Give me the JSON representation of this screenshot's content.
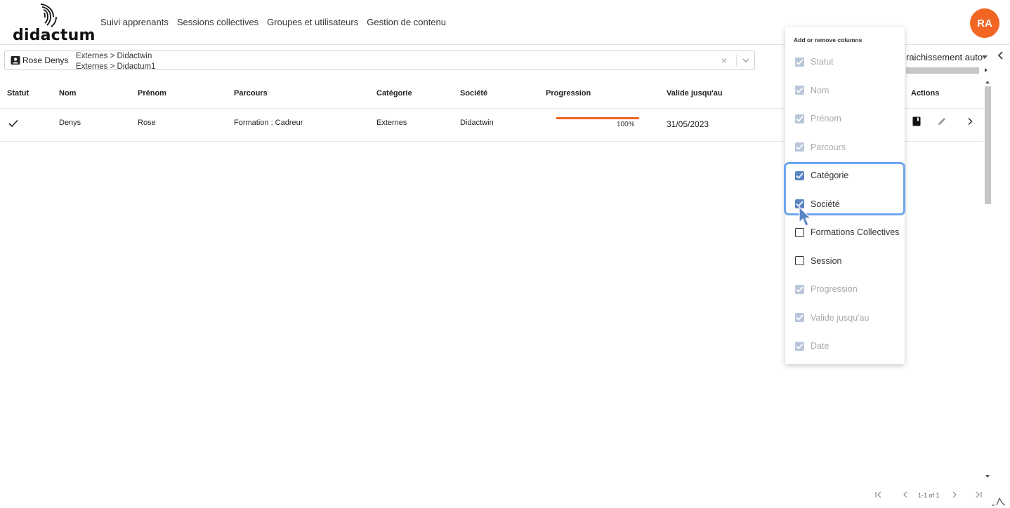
{
  "app": {
    "logo_text": "didactum",
    "nav": [
      "Suivi apprenants",
      "Sessions collectives",
      "Groupes et utilisateurs",
      "Gestion de contenu"
    ],
    "avatar_initials": "RA",
    "accent_color": "#f26522"
  },
  "filter": {
    "chip_label": "Rose Denys",
    "paths": [
      "Externes > Didactwin",
      "Externes > Didactum1"
    ],
    "clear_symbol": "×"
  },
  "toolbar": {
    "refresh_label": "raichissement auto"
  },
  "table": {
    "columns": [
      "Statut",
      "Nom",
      "Prénom",
      "Parcours",
      "Catégorie",
      "Société",
      "Progression",
      "Valide jusqu'au",
      "Actions"
    ],
    "rows": [
      {
        "statut": "check-icon",
        "nom": "Denys",
        "prenom": "Rose",
        "parcours": "Formation : Cadreur",
        "categorie": "Externes",
        "societe": "Didactwin",
        "progression_pct": 100,
        "progression_label": "100%",
        "valide": "31/05/2023"
      }
    ]
  },
  "pagination": {
    "range": "1-1 of 1"
  },
  "column_menu": {
    "title": "Add or remove columns",
    "options": [
      {
        "label": "Statut",
        "state": "disabled-checked"
      },
      {
        "label": "Nom",
        "state": "disabled-checked"
      },
      {
        "label": "Prénom",
        "state": "disabled-checked"
      },
      {
        "label": "Parcours",
        "state": "disabled-checked"
      },
      {
        "label": "Catégorie",
        "state": "checked"
      },
      {
        "label": "Société",
        "state": "checked"
      },
      {
        "label": "Formations Collectives",
        "state": "unchecked"
      },
      {
        "label": "Session",
        "state": "unchecked"
      },
      {
        "label": "Progression",
        "state": "disabled-checked"
      },
      {
        "label": "Valide jusqu'au",
        "state": "disabled-checked"
      },
      {
        "label": "Date",
        "state": "disabled-checked"
      }
    ]
  }
}
